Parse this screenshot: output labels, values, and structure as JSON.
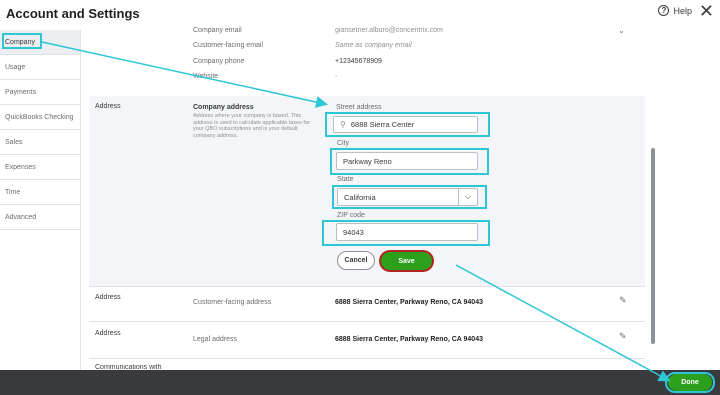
{
  "header": {
    "title": "Account and Settings",
    "help_label": "Help",
    "help_icon": "?",
    "close_icon": "✕"
  },
  "sidebar": {
    "items": [
      {
        "label": "Company"
      },
      {
        "label": "Usage"
      },
      {
        "label": "Payments"
      },
      {
        "label": "QuickBooks Checking"
      },
      {
        "label": "Sales"
      },
      {
        "label": "Expenses"
      },
      {
        "label": "Time"
      },
      {
        "label": "Advanced"
      }
    ]
  },
  "contact": {
    "email_label": "Company email",
    "email_value": "giansetner.alburo@concentrix.com",
    "customer_email_label": "Customer-facing email",
    "customer_email_value": "Same as company email",
    "phone_label": "Company phone",
    "phone_value": "+12345678909",
    "website_label": "Website",
    "website_value": "-"
  },
  "address_edit": {
    "section_label": "Address",
    "title": "Company address",
    "description": "Address where your company is based. This address is used to calculate applicable taxes for your QBO subscriptions and is your default company address.",
    "street_label": "Street address",
    "street_value": "6888 Sierra Center",
    "city_label": "City",
    "city_value": "Parkway Reno",
    "state_label": "State",
    "state_value": "California",
    "zip_label": "ZIP code",
    "zip_value": "94043",
    "cancel_label": "Cancel",
    "save_label": "Save"
  },
  "customer_address": {
    "section_label": "Address",
    "label": "Customer-facing address",
    "value": "6888 Sierra Center, Parkway Reno, CA 94043"
  },
  "legal_address": {
    "section_label": "Address",
    "label": "Legal address",
    "value": "6888 Sierra Center, Parkway Reno, CA 94043"
  },
  "communications": {
    "label": "Communications with"
  },
  "footer": {
    "done_label": "Done"
  },
  "colors": {
    "accent": "#2ca01c",
    "highlight": "#2dc6d6",
    "footer": "#393a3d"
  }
}
